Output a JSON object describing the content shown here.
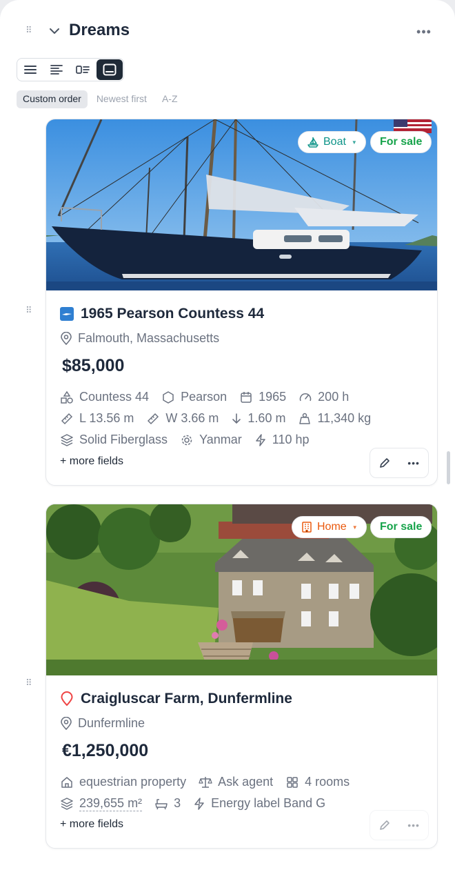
{
  "header": {
    "title": "Dreams"
  },
  "view_modes": [
    "list-icon",
    "compact-icon",
    "details-icon",
    "gallery-icon"
  ],
  "active_view": "gallery",
  "sort": {
    "options": [
      "Custom order",
      "Newest first",
      "A-Z"
    ],
    "active": "Custom order"
  },
  "cards": [
    {
      "type_badge": "Boat",
      "status_badge": "For sale",
      "title": "1965 Pearson Countess 44",
      "location": "Falmouth, Massachusetts",
      "price": "$85,000",
      "fields": [
        [
          "Countess 44",
          "Pearson",
          "1965",
          "200 h"
        ],
        [
          "L 13.56 m",
          "W 3.66 m",
          "1.60 m",
          "11,340 kg"
        ],
        [
          "Solid Fiberglass",
          "Yanmar",
          "110 hp"
        ]
      ],
      "more_fields": "+ more fields"
    },
    {
      "type_badge": "Home",
      "status_badge": "For sale",
      "title": "Craigluscar Farm, Dunfermline",
      "location": "Dunfermline",
      "price": "€1,250,000",
      "fields": [
        [
          "equestrian property",
          "Ask agent",
          "4 rooms"
        ],
        [
          "239,655 m²",
          "3",
          "Energy label Band G"
        ]
      ],
      "more_fields": "+ more fields"
    }
  ],
  "colors": {
    "boat_badge": "#0d9488",
    "home_badge": "#ea580c",
    "for_sale": "#16a34a",
    "dark": "#1f2a37"
  }
}
